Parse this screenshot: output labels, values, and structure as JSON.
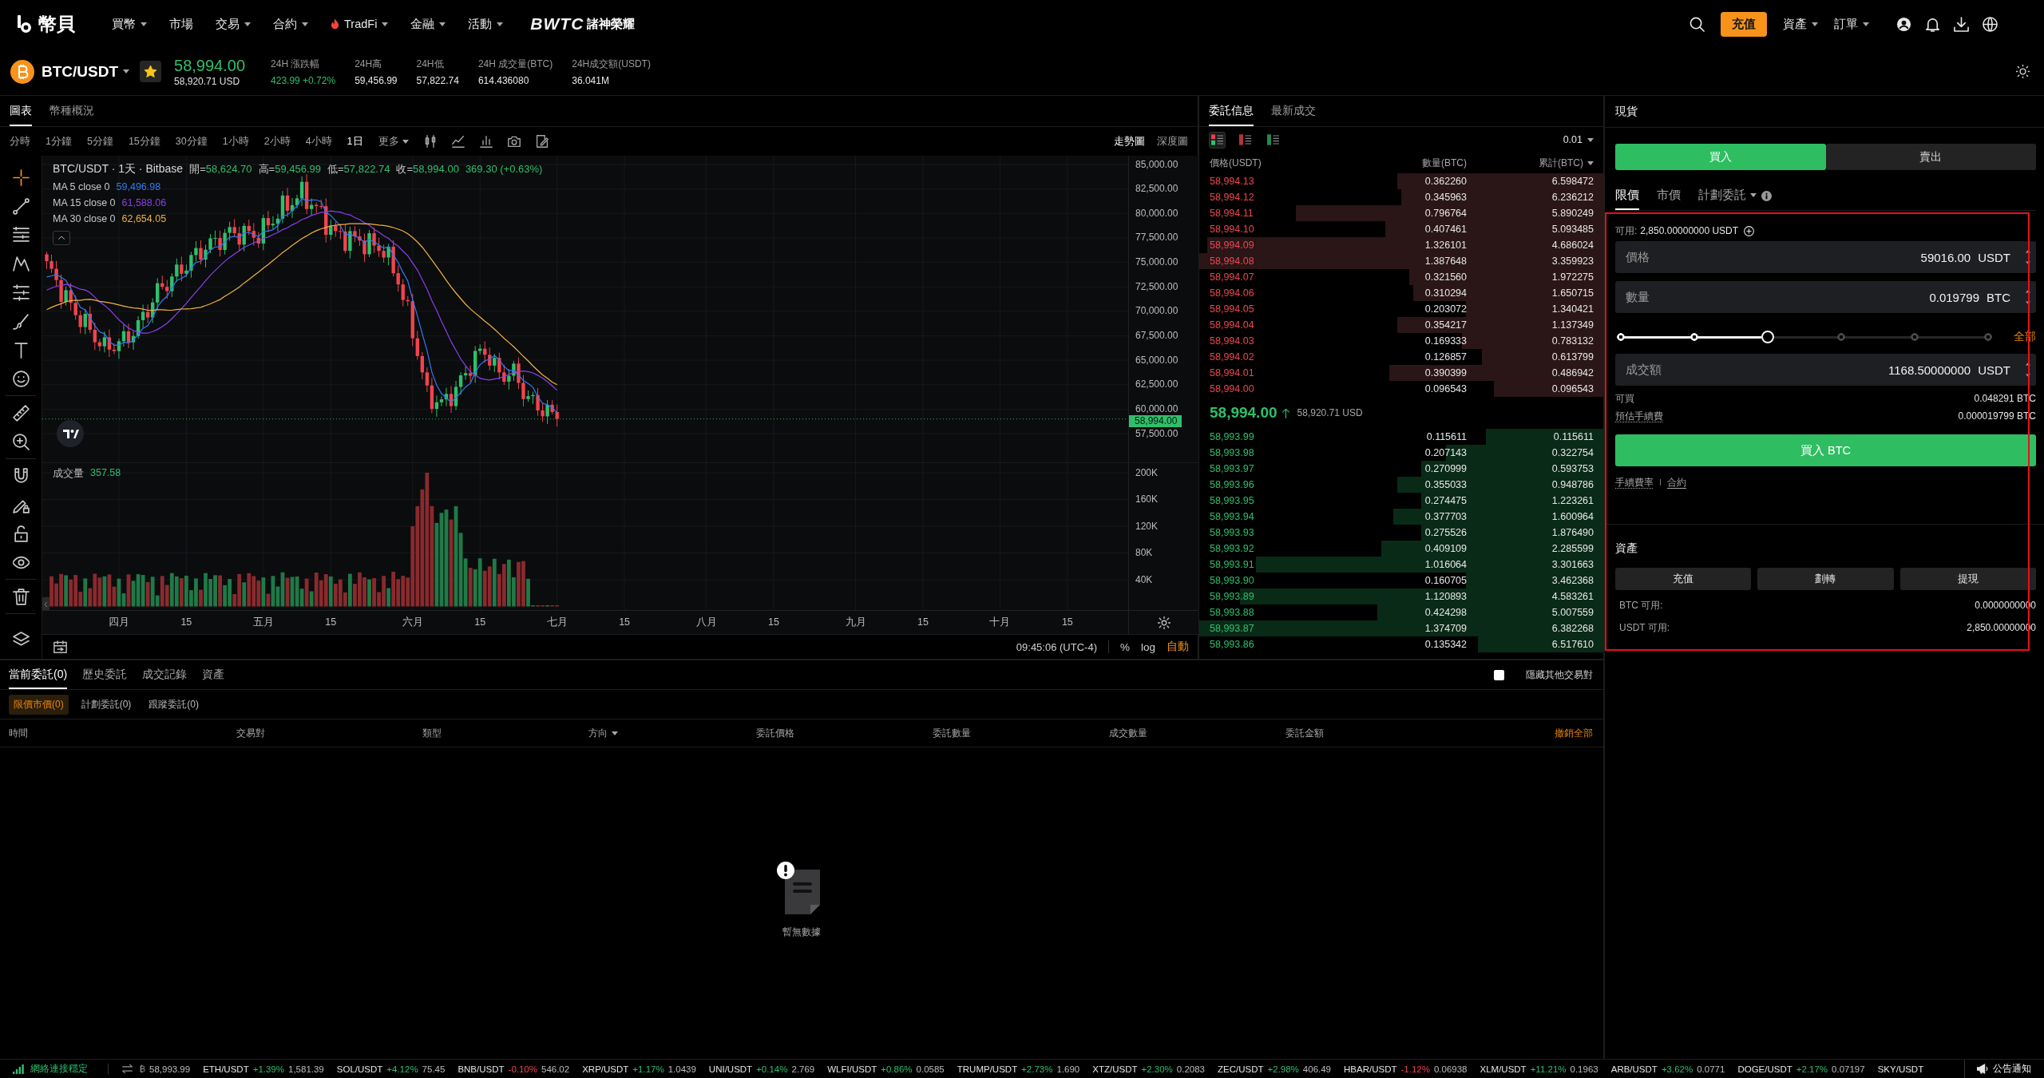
{
  "top_nav": {
    "logo": "幣貝",
    "menu": [
      {
        "label": "買幣",
        "dropdown": true,
        "kind": "plain"
      },
      {
        "label": "市場",
        "dropdown": false,
        "kind": "plain"
      },
      {
        "label": "交易",
        "dropdown": true,
        "kind": "plain"
      },
      {
        "label": "合約",
        "dropdown": true,
        "kind": "plain"
      },
      {
        "label": "TradFi",
        "dropdown": true,
        "kind": "hot"
      },
      {
        "label": "金融",
        "dropdown": true,
        "kind": "plain"
      },
      {
        "label": "活動",
        "dropdown": true,
        "kind": "plain"
      }
    ],
    "promo": {
      "brand": "BWTC",
      "title": "諸神榮耀"
    },
    "deposit": "充值",
    "menus": [
      {
        "label": "資產",
        "dropdown": true
      },
      {
        "label": "訂單",
        "dropdown": true
      }
    ]
  },
  "market": {
    "symbol": "BTC/USDT",
    "favorite": true,
    "price": "58,994.00",
    "price_usd": "58,920.71 USD",
    "stats": [
      {
        "label": "24H 漲跌幅",
        "value": "423.99 +0.72%",
        "kind": "change"
      },
      {
        "label": "24H高",
        "value": "59,456.99",
        "kind": "plain"
      },
      {
        "label": "24H低",
        "value": "57,822.74",
        "kind": "plain"
      },
      {
        "label": "24H 成交量(BTC)",
        "value": "614.436080",
        "kind": "plain"
      },
      {
        "label": "24H成交額(USDT)",
        "value": "36.041M",
        "kind": "plain"
      }
    ]
  },
  "chart_panel": {
    "tabs": [
      {
        "label": "圖表",
        "selected": true
      },
      {
        "label": "幣種概況",
        "selected": false
      }
    ],
    "intervals": [
      {
        "label": "分時",
        "selected": false
      },
      {
        "label": "1分鐘",
        "selected": false
      },
      {
        "label": "5分鐘",
        "selected": false
      },
      {
        "label": "15分鐘",
        "selected": false
      },
      {
        "label": "30分鐘",
        "selected": false
      },
      {
        "label": "1小時",
        "selected": false
      },
      {
        "label": "2小時",
        "selected": false
      },
      {
        "label": "4小時",
        "selected": false
      },
      {
        "label": "1日",
        "selected": true
      }
    ],
    "more": "更多",
    "views": [
      {
        "label": "走勢圖",
        "selected": true
      },
      {
        "label": "深度圖",
        "selected": false
      }
    ],
    "drawing_tools": [
      {
        "tools": [
          {
            "kind": "crosshair",
            "selected": true
          },
          {
            "kind": "trend-line",
            "selected": false
          },
          {
            "kind": "horizontal-lines",
            "selected": false
          },
          {
            "kind": "pattern",
            "selected": false
          },
          {
            "kind": "parallel-lines",
            "selected": false
          },
          {
            "kind": "brush",
            "selected": false
          },
          {
            "kind": "text-tool",
            "selected": false
          },
          {
            "kind": "smiley",
            "selected": false
          }
        ]
      },
      {
        "tools": [
          {
            "kind": "ruler",
            "selected": false
          },
          {
            "kind": "zoom-in",
            "selected": false
          }
        ]
      },
      {
        "tools": [
          {
            "kind": "magnet",
            "selected": false
          },
          {
            "kind": "pencil-lock",
            "selected": false
          },
          {
            "kind": "lock",
            "selected": false
          },
          {
            "kind": "eye",
            "selected": false
          }
        ]
      },
      {
        "tools": [
          {
            "kind": "trash",
            "selected": false
          }
        ]
      },
      {
        "tools": [
          {
            "kind": "layers",
            "selected": false
          }
        ]
      }
    ],
    "legend": {
      "title": "BTC/USDT · 1天 · Bitbase",
      "ohlc": [
        {
          "label": "開=",
          "value": "58,624.70"
        },
        {
          "label": "高=",
          "value": "59,456.99"
        },
        {
          "label": "低=",
          "value": "57,822.74"
        },
        {
          "label": "收=",
          "value": "58,994.00"
        }
      ],
      "change": "369.30 (+0.63%)",
      "ma": [
        {
          "label": "MA 5 close 0",
          "value": "59,496.98",
          "color": "#2f7bf5"
        },
        {
          "label": "MA 15 close 0",
          "value": "61,588.06",
          "color": "#8a3ff0"
        },
        {
          "label": "MA 30 close 0",
          "value": "62,654.05",
          "color": "#f0b23c"
        }
      ]
    },
    "price_axis": [
      "85,000.00",
      "82,500.00",
      "80,000.00",
      "77,500.00",
      "75,000.00",
      "72,500.00",
      "70,000.00",
      "67,500.00",
      "65,000.00",
      "62,500.00",
      "60,000.00",
      "57,500.00"
    ],
    "price_tag": "58,994.00",
    "volume": {
      "label": "成交量",
      "value": "357.58",
      "axis": [
        "200K",
        "160K",
        "120K",
        "80K",
        "40K"
      ]
    },
    "time_axis": [
      "四月",
      "15",
      "五月",
      "15",
      "六月",
      "15",
      "七月",
      "15",
      "八月",
      "15",
      "九月",
      "15",
      "十月",
      "15"
    ],
    "time": "09:45:06 (UTC-4)",
    "scale_options": [
      {
        "label": "%",
        "selected": false
      },
      {
        "label": "log",
        "selected": false
      },
      {
        "label": "自動",
        "selected": true
      }
    ]
  },
  "order_book": {
    "tabs": [
      {
        "label": "委託信息",
        "selected": true
      },
      {
        "label": "最新成交",
        "selected": false
      }
    ],
    "views": [
      {
        "kind": "both",
        "selected": true
      },
      {
        "kind": "asks",
        "selected": false
      },
      {
        "kind": "bids",
        "selected": false
      }
    ],
    "precision": "0.01",
    "columns": [
      "價格(USDT)",
      "數量(BTC)",
      "累計(BTC)"
    ],
    "asks": [
      {
        "price": "58,994.13",
        "amount": "0.362260",
        "total": "6.598472",
        "level": 0.51
      },
      {
        "price": "58,994.12",
        "amount": "0.345963",
        "total": "6.236212",
        "level": 0.5
      },
      {
        "price": "58,994.11",
        "amount": "0.796764",
        "total": "5.890249",
        "level": 0.76
      },
      {
        "price": "58,994.10",
        "amount": "0.407461",
        "total": "5.093485",
        "level": 0.54
      },
      {
        "price": "58,994.09",
        "amount": "1.326101",
        "total": "4.686024",
        "level": 0.98
      },
      {
        "price": "58,994.08",
        "amount": "1.387648",
        "total": "3.359923",
        "level": 1
      },
      {
        "price": "58,994.07",
        "amount": "0.321560",
        "total": "1.972275",
        "level": 0.48
      },
      {
        "price": "58,994.06",
        "amount": "0.310294",
        "total": "1.650715",
        "level": 0.47
      },
      {
        "price": "58,994.05",
        "amount": "0.203072",
        "total": "1.340421",
        "level": 0.34
      },
      {
        "price": "58,994.04",
        "amount": "0.354217",
        "total": "1.137349",
        "level": 0.51
      },
      {
        "price": "58,994.03",
        "amount": "0.169333",
        "total": "0.783132",
        "level": 0.35
      },
      {
        "price": "58,994.02",
        "amount": "0.126857",
        "total": "0.613799",
        "level": 0.3
      },
      {
        "price": "58,994.01",
        "amount": "0.390399",
        "total": "0.486942",
        "level": 0.53
      },
      {
        "price": "58,994.00",
        "amount": "0.096543",
        "total": "0.096543",
        "level": 0.27
      }
    ],
    "last_price": "58,994.00",
    "last_price_usd": "58,920.71 USD",
    "bids": [
      {
        "price": "58,993.99",
        "amount": "0.115611",
        "total": "0.115611",
        "level": 0.29
      },
      {
        "price": "58,993.98",
        "amount": "0.207143",
        "total": "0.322754",
        "level": 0.39
      },
      {
        "price": "58,993.97",
        "amount": "0.270999",
        "total": "0.593753",
        "level": 0.45
      },
      {
        "price": "58,993.96",
        "amount": "0.355033",
        "total": "0.948786",
        "level": 0.51
      },
      {
        "price": "58,993.95",
        "amount": "0.274475",
        "total": "1.223261",
        "level": 0.45
      },
      {
        "price": "58,993.94",
        "amount": "0.377703",
        "total": "1.600964",
        "level": 0.52
      },
      {
        "price": "58,993.93",
        "amount": "0.275526",
        "total": "1.876490",
        "level": 0.45
      },
      {
        "price": "58,993.92",
        "amount": "0.409109",
        "total": "2.285599",
        "level": 0.55
      },
      {
        "price": "58,993.91",
        "amount": "1.016064",
        "total": "3.301663",
        "level": 0.86
      },
      {
        "price": "58,993.90",
        "amount": "0.160705",
        "total": "3.462368",
        "level": 0.34
      },
      {
        "price": "58,993.89",
        "amount": "1.120893",
        "total": "4.583261",
        "level": 0.9
      },
      {
        "price": "58,993.88",
        "amount": "0.424298",
        "total": "5.007559",
        "level": 0.56
      },
      {
        "price": "58,993.87",
        "amount": "1.374709",
        "total": "6.382268",
        "level": 1
      },
      {
        "price": "58,993.86",
        "amount": "0.135342",
        "total": "6.517610",
        "level": 0.31
      }
    ]
  },
  "order_form": {
    "title": "現貨",
    "sides": [
      {
        "label": "買入",
        "selected": true
      },
      {
        "label": "賣出",
        "selected": false
      }
    ],
    "order_types": [
      {
        "label": "限價",
        "selected": true,
        "dropdown": false
      },
      {
        "label": "市價",
        "selected": false,
        "dropdown": false
      },
      {
        "label": "計劃委託",
        "selected": false,
        "dropdown": true
      }
    ],
    "available": {
      "label": "可用:",
      "value": "2,850.00000000 USDT"
    },
    "fields": [
      {
        "label": "價格",
        "value": "59016.00",
        "unit": "USDT"
      },
      {
        "label": "數量",
        "value": "0.019799",
        "unit": "BTC"
      }
    ],
    "slider": {
      "level": 0.4,
      "max_label": "全部"
    },
    "total_field": {
      "label": "成交額",
      "value": "1168.50000000",
      "unit": "USDT"
    },
    "info": [
      {
        "label": "可買",
        "value": "0.048291 BTC",
        "underlined": false
      },
      {
        "label": "預估手續費",
        "value": "0.000019799 BTC",
        "underlined": true
      }
    ],
    "submit": "買入 BTC",
    "links": [
      {
        "label": "手續費率",
        "kind": "dotted"
      },
      {
        "label": "合約",
        "kind": "solid"
      }
    ],
    "assets": {
      "title": "資產",
      "buttons": [
        "充值",
        "劃轉",
        "提現"
      ],
      "balances": [
        {
          "label": "BTC 可用:",
          "value": "0.0000000000"
        },
        {
          "label": "USDT 可用:",
          "value": "2,850.00000000"
        }
      ]
    }
  },
  "orders": {
    "tabs": [
      {
        "label": "當前委託(0)",
        "selected": true
      },
      {
        "label": "歷史委託",
        "selected": false
      },
      {
        "label": "成交記錄",
        "selected": false
      },
      {
        "label": "資產",
        "selected": false
      }
    ],
    "hide_others": {
      "label": "隱藏其他交易對",
      "checked": false
    },
    "subtabs": [
      {
        "label": "限價市價(0)",
        "selected": true
      },
      {
        "label": "計劃委託(0)",
        "selected": false
      },
      {
        "label": "跟蹤委託(0)",
        "selected": false
      }
    ],
    "columns": [
      {
        "label": "時間",
        "dropdown": false
      },
      {
        "label": "交易對",
        "dropdown": false
      },
      {
        "label": "類型",
        "dropdown": false
      },
      {
        "label": "方向",
        "dropdown": true
      },
      {
        "label": "委託價格",
        "dropdown": false
      },
      {
        "label": "委託數量",
        "dropdown": false
      },
      {
        "label": "成交數量",
        "dropdown": false
      },
      {
        "label": "委託金額",
        "dropdown": false
      }
    ],
    "cancel_all": "撤銷全部",
    "empty": "暫無數據"
  },
  "status_bar": {
    "connection": "網絡連接穩定",
    "index_price": "58,993.99",
    "tickers": [
      {
        "pair": "ETH/USDT",
        "change": "+1.39%",
        "price": "1,581.39",
        "rising": true
      },
      {
        "pair": "SOL/USDT",
        "change": "+4.12%",
        "price": "75.45",
        "rising": true
      },
      {
        "pair": "BNB/USDT",
        "change": "-0.10%",
        "price": "546.02",
        "rising": false
      },
      {
        "pair": "XRP/USDT",
        "change": "+1.17%",
        "price": "1.0439",
        "rising": true
      },
      {
        "pair": "UNI/USDT",
        "change": "+0.14%",
        "price": "2.769",
        "rising": true
      },
      {
        "pair": "WLFI/USDT",
        "change": "+0.86%",
        "price": "0.0585",
        "rising": true
      },
      {
        "pair": "TRUMP/USDT",
        "change": "+2.73%",
        "price": "1.690",
        "rising": true
      },
      {
        "pair": "XTZ/USDT",
        "change": "+2.30%",
        "price": "0.2083",
        "rising": true
      },
      {
        "pair": "ZEC/USDT",
        "change": "+2.98%",
        "price": "406.49",
        "rising": true
      },
      {
        "pair": "HBAR/USDT",
        "change": "-1.12%",
        "price": "0.06938",
        "rising": false
      },
      {
        "pair": "XLM/USDT",
        "change": "+11.21%",
        "price": "0.1963",
        "rising": true
      },
      {
        "pair": "ARB/USDT",
        "change": "+3.62%",
        "price": "0.0771",
        "rising": true
      },
      {
        "pair": "DOGE/USDT",
        "change": "+2.17%",
        "price": "0.07197",
        "rising": true
      },
      {
        "pair": "SKY/USDT"
      }
    ],
    "notice": "公告通知"
  }
}
